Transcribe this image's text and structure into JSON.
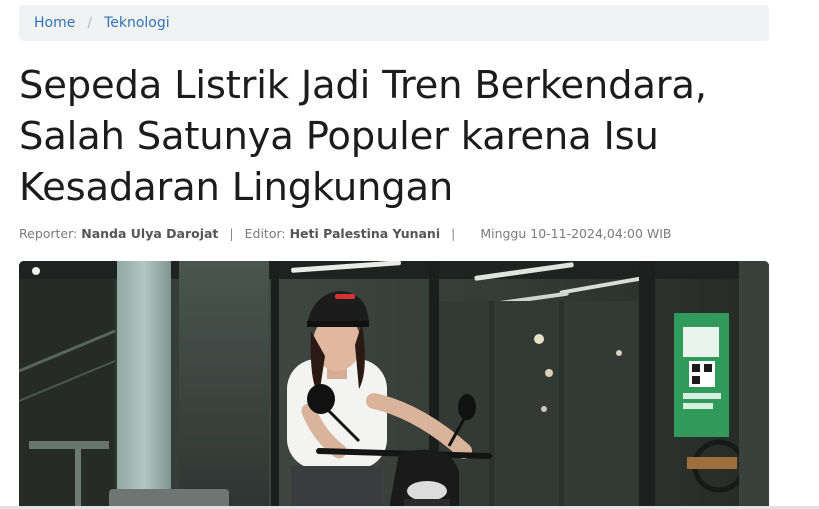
{
  "breadcrumb": {
    "home": "Home",
    "separator": "/",
    "category": "Teknologi"
  },
  "article": {
    "title": "Sepeda Listrik Jadi Tren Berkendara, Salah Satunya Populer karena Isu Kesadaran Lingkungan",
    "reporter_label": "Reporter:",
    "reporter_name": "Nanda Ulya Darojat",
    "editor_label": "Editor:",
    "editor_name": "Heti Palestina Yunani",
    "date": "Minggu 10-11-2024,04:00 WIB"
  },
  "colors": {
    "link": "#2f73b4",
    "breadcrumb_bg": "#f1f2f4",
    "title_text": "#1c1c1c",
    "meta_text": "#7a7a7a"
  },
  "hero_image": {
    "icon": "photo-woman-on-electric-scooter"
  }
}
